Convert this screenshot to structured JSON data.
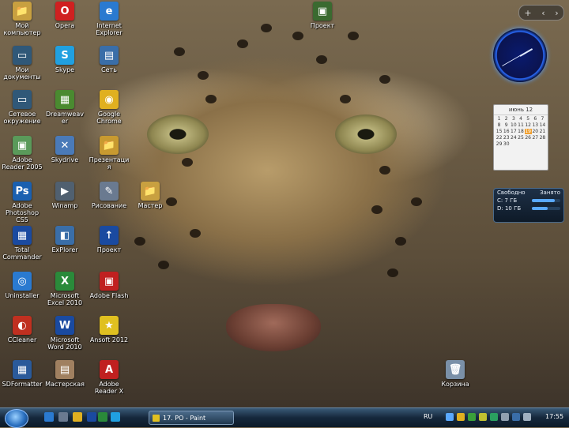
{
  "desktop": {
    "icons": [
      {
        "label": "Мой компьютер",
        "color": "#c8a040",
        "glyph": "📁"
      },
      {
        "label": "Opera",
        "color": "#d02020",
        "glyph": "O"
      },
      {
        "label": "Internet Explorer",
        "color": "#2a7ad0",
        "glyph": "e"
      },
      {
        "label": "Мои документы",
        "color": "#305878",
        "glyph": "▭"
      },
      {
        "label": "Skype",
        "color": "#20a0e0",
        "glyph": "S"
      },
      {
        "label": "Сеть",
        "color": "#3a6ea8",
        "glyph": "▤"
      },
      {
        "label": "Сетевое окружение",
        "color": "#305878",
        "glyph": "▭"
      },
      {
        "label": "Dreamweaver",
        "color": "#4a8a30",
        "glyph": "▦"
      },
      {
        "label": "Google Chrome",
        "color": "#e0b020",
        "glyph": "◉"
      },
      {
        "label": "Adobe Reader 2005",
        "color": "#5a9a5a",
        "glyph": "▣"
      },
      {
        "label": "Skydrive",
        "color": "#4a7ab8",
        "glyph": "✕"
      },
      {
        "label": "Презентация",
        "color": "#c89a30",
        "glyph": "📁"
      },
      {
        "label": "Adobe Photoshop CS5",
        "color": "#1a60b0",
        "glyph": "Ps"
      },
      {
        "label": "Winamp",
        "color": "#506070",
        "glyph": "▶"
      },
      {
        "label": "Рисование",
        "color": "#6a7a90",
        "glyph": "✎"
      },
      {
        "label": "Total Commander",
        "color": "#1a4aa0",
        "glyph": "▦"
      },
      {
        "label": "ExPlorer",
        "color": "#3a6ea8",
        "glyph": "◧"
      },
      {
        "label": "Проект",
        "color": "#1a4aa0",
        "glyph": "↑"
      },
      {
        "label": "Uninstaller",
        "color": "#2a7ad0",
        "glyph": "◎"
      },
      {
        "label": "Microsoft Excel 2010",
        "color": "#2a8a3a",
        "glyph": "X"
      },
      {
        "label": "Adobe Flash",
        "color": "#c02020",
        "glyph": "▣"
      },
      {
        "label": "CCleaner",
        "color": "#c03020",
        "glyph": "◐"
      },
      {
        "label": "Microsoft Word 2010",
        "color": "#1a4aa0",
        "glyph": "W"
      },
      {
        "label": "Ansoft 2012",
        "color": "#e0c020",
        "glyph": "★"
      },
      {
        "label": "SDFormatter",
        "color": "#2a5a9a",
        "glyph": "▦"
      },
      {
        "label": "Мастерская",
        "color": "#a08060",
        "glyph": "▤"
      },
      {
        "label": "Adobe Reader X",
        "color": "#c02020",
        "glyph": "A"
      },
      {
        "label": "Мастер",
        "color": "#c8a040",
        "glyph": "📁"
      },
      {
        "label": "Проект",
        "color": "#3a6a30",
        "glyph": "▣"
      },
      {
        "label": "Корзина",
        "color": "#7a90a8",
        "glyph": "🗑"
      }
    ]
  },
  "sidebar": {
    "add_label": "+",
    "prev_label": "‹",
    "next_label": "›"
  },
  "calendar": {
    "header": "июнь 12",
    "days": [
      "1",
      "2",
      "3",
      "4",
      "5",
      "6",
      "7",
      "8",
      "9",
      "10",
      "11",
      "12",
      "13",
      "14",
      "15",
      "16",
      "17",
      "18",
      "19",
      "20",
      "21",
      "22",
      "23",
      "24",
      "25",
      "26",
      "27",
      "28",
      "29",
      "30"
    ],
    "today": "19"
  },
  "drives": {
    "header_free": "Свободно",
    "header_used": "Занято",
    "rows": [
      {
        "label": "C: 7 ГБ",
        "fill": 0.8
      },
      {
        "label": "D: 10 ГБ",
        "fill": 0.55
      }
    ]
  },
  "taskbar": {
    "task_label": "17. PO - Paint",
    "lang": "RU",
    "time": "17:55"
  },
  "colors": {
    "accent": "#2a70c0",
    "taskbar": "#15283c"
  }
}
